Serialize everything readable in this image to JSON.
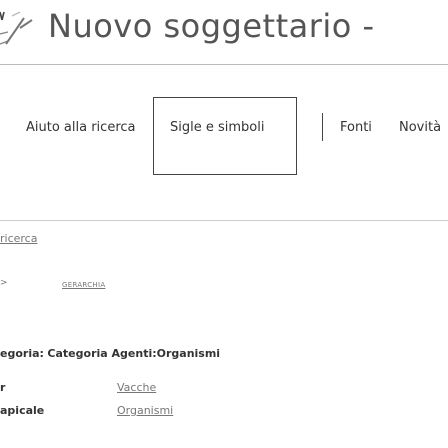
{
  "header": {
    "title": "Nuovo soggettario - "
  },
  "nav": {
    "items": [
      {
        "label": "Aiuto alla ricerca"
      },
      {
        "label": "Sigle e simboli"
      },
      {
        "label": "Fonti"
      },
      {
        "label": "Novità"
      }
    ]
  },
  "content": {
    "breadcrumb_link": "ricerca",
    "hierarchy_link": "GERARCHIA",
    "category": {
      "label": "egoria:",
      "value": "Categoria Agenti:Organismi"
    },
    "relations": [
      {
        "label": "r",
        "link": "Vacche"
      },
      {
        "label": "apicale",
        "link": "Organismi"
      }
    ]
  },
  "colors": {
    "link": "#777777",
    "text": "#333333",
    "title": "#555555"
  }
}
